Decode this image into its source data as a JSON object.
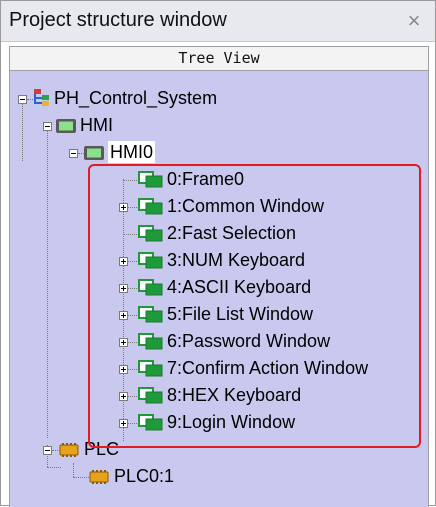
{
  "window": {
    "title": "Project structure window",
    "close_glyph": "×"
  },
  "tree_header": {
    "label": "Tree View"
  },
  "tree": {
    "root": {
      "label": "PH_Control_System",
      "icon": "project-tree-icon"
    },
    "hmi": {
      "label": "HMI",
      "icon": "hmi-device-icon"
    },
    "hmi0": {
      "label": "HMI0",
      "icon": "hmi-device-icon"
    },
    "windows": [
      {
        "label": "0:Frame0",
        "expandable": false
      },
      {
        "label": "1:Common Window",
        "expandable": true
      },
      {
        "label": "2:Fast Selection",
        "expandable": false
      },
      {
        "label": "3:NUM Keyboard",
        "expandable": true
      },
      {
        "label": "4:ASCII Keyboard",
        "expandable": true
      },
      {
        "label": "5:File List Window",
        "expandable": true
      },
      {
        "label": "6:Password Window",
        "expandable": true
      },
      {
        "label": "7:Confirm Action Window",
        "expandable": true
      },
      {
        "label": "8:HEX Keyboard",
        "expandable": true
      },
      {
        "label": "9:Login Window",
        "expandable": true
      }
    ],
    "plc": {
      "label": "PLC",
      "icon": "plc-chip-icon"
    },
    "plc0": {
      "label": "PLC0:1",
      "icon": "plc-chip-icon"
    }
  },
  "colors": {
    "tree_background": "#c9c9ef",
    "highlight_border": "#e41b23",
    "window_icon": "#1f9a3a"
  }
}
